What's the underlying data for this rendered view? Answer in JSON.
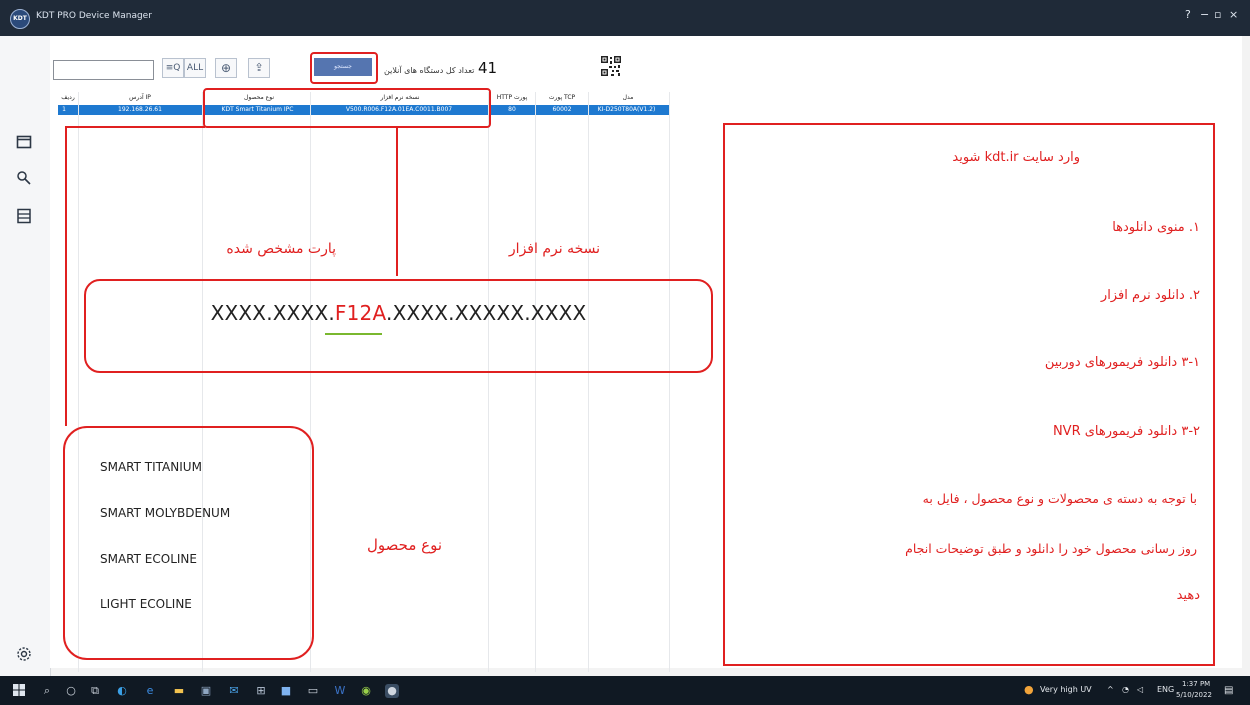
{
  "window": {
    "logo_text": "KDT",
    "title": "KDT PRO Device Manager",
    "help": "?",
    "minimize": "−",
    "maximize": "▫",
    "close": "×"
  },
  "toolbar": {
    "search_value": "",
    "search_icon_btn": "≡Q",
    "all_btn": "ALL",
    "globe_btn": "⊕",
    "upload_btn": "⇪",
    "scan_label": "جستجو",
    "online_label": "تعداد کل دستگاه های آنلاین",
    "online_count": "41"
  },
  "table": {
    "headers": [
      "مدل",
      "پورت TCP",
      "HTTP پورت",
      "نسخه نرم افزار",
      "نوع محصول",
      "آدرس IP",
      "ردیف"
    ],
    "row": [
      "KI-D250T80A(V1.2)",
      "60002",
      "80",
      "V500.R006.F12A.01EA.C0011.B007",
      "KDT Smart Titanium IPC",
      "192.168.26.61",
      "1"
    ]
  },
  "annotations": {
    "part_label": "پارت مشخص شده",
    "version_label": "نسخه نرم افزار",
    "version_prefix": "XXXX.XXXX.",
    "version_highlight": "F12A",
    "version_suffix": ".XXXX.XXXXX.XXXX",
    "products_label": "نوع محصول",
    "products": [
      "SMART TITANIUM",
      "SMART MOLYBDENUM",
      "SMART ECOLINE",
      "LIGHT ECOLINE"
    ]
  },
  "info": {
    "line1": "وارد سایت kdt.ir شوید",
    "line2": "۱. منوی دانلودها",
    "line3": "۲. دانلود نرم افزار",
    "line4": "۳-۱ دانلود فریمورهای دوربین",
    "line5": "۳-۲ دانلود فریمورهای NVR",
    "line6": "با توجه به دسته ی محصولات و نوع محصول ، فایل به",
    "line7": "روز رسانی محصول خود را دانلود و طبق توضیحات انجام",
    "line8": "دهید"
  },
  "taskbar": {
    "weather": "Very high UV",
    "lang": "ENG",
    "time": "1:37 PM",
    "date": "5/10/2022"
  },
  "colors": {
    "accent_red": "#e02020",
    "selection_blue": "#1e79d0",
    "underline_green": "#7ab82f"
  }
}
